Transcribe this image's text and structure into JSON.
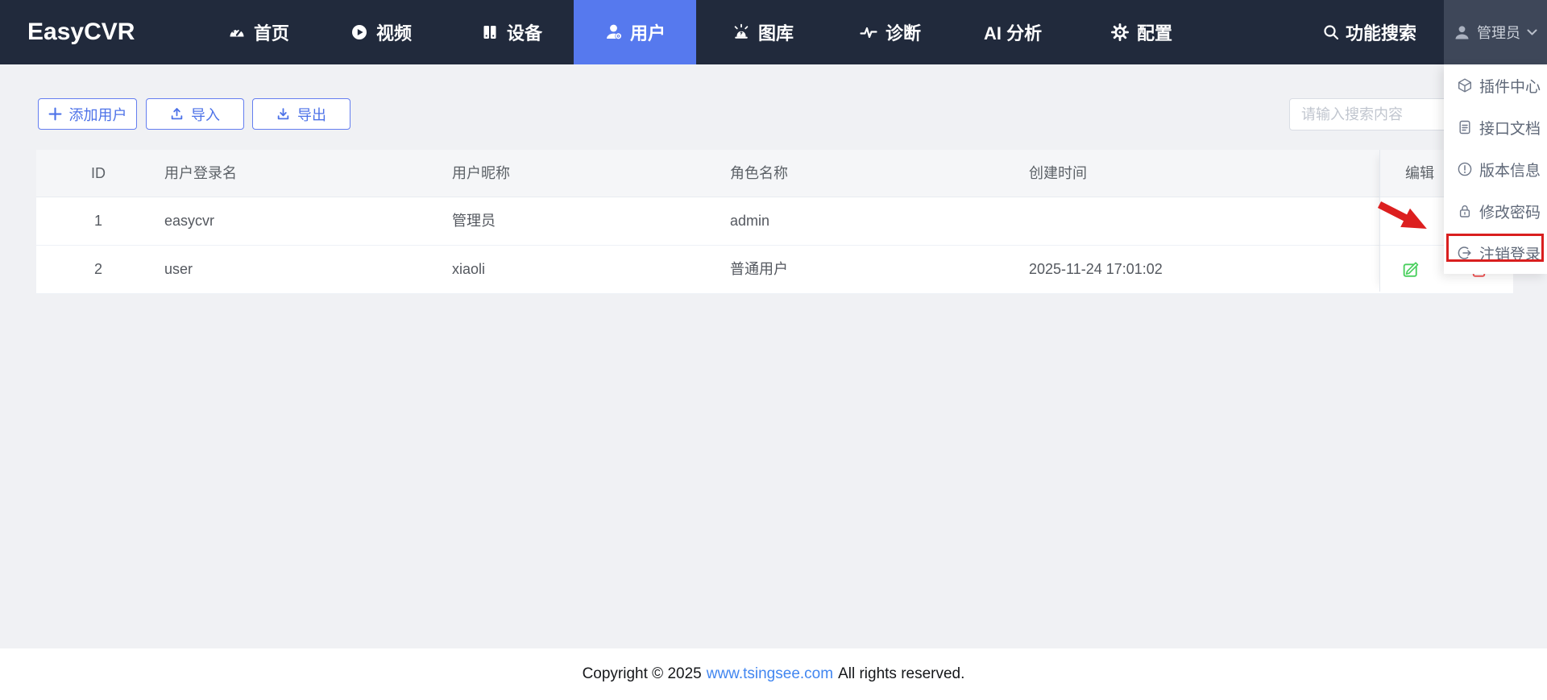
{
  "navbar": {
    "logo": "EasyCVR",
    "items": [
      {
        "label": "首页",
        "icon": "dashboard-icon"
      },
      {
        "label": "视频",
        "icon": "play-icon"
      },
      {
        "label": "设备",
        "icon": "device-icon"
      },
      {
        "label": "用户",
        "icon": "user-icon",
        "active": true
      },
      {
        "label": "图库",
        "icon": "siren-icon"
      },
      {
        "label": "诊断",
        "icon": "pulse-icon"
      },
      {
        "label": "AI 分析",
        "icon": null
      },
      {
        "label": "配置",
        "icon": "gear-icon"
      }
    ],
    "function_search_label": "功能搜索",
    "admin_label": "管理员"
  },
  "user_menu": {
    "items": [
      {
        "label": "插件中心",
        "icon": "plugin-cube-icon"
      },
      {
        "label": "接口文档",
        "icon": "document-icon"
      },
      {
        "label": "版本信息",
        "icon": "version-info-icon"
      },
      {
        "label": "修改密码",
        "icon": "lock-icon"
      },
      {
        "label": "注销登录",
        "icon": "logout-icon",
        "highlighted": true
      }
    ]
  },
  "toolbar": {
    "add_user_label": "添加用户",
    "import_label": "导入",
    "export_label": "导出",
    "search_placeholder": "请输入搜索内容"
  },
  "table": {
    "columns": [
      "ID",
      "用户登录名",
      "用户昵称",
      "角色名称",
      "创建时间",
      "编辑"
    ],
    "rows": [
      {
        "id": "1",
        "login": "easycvr",
        "nickname": "管理员",
        "role": "admin",
        "created": ""
      },
      {
        "id": "2",
        "login": "user",
        "nickname": "xiaoli",
        "role": "普通用户",
        "created": "2025-11-24 17:01:02"
      }
    ]
  },
  "footer": {
    "copyright_prefix": "Copyright © 2025",
    "link_text": "www.tsingsee.com",
    "copyright_suffix": "All rights reserved."
  },
  "colors": {
    "navbar_bg": "#212a3c",
    "active_tab_blue": "#5679ee",
    "admin_area_bg": "#3e4759",
    "button_blue": "#4d72e8",
    "annotation_red": "#d91f1f",
    "edit_green": "#49cf5d",
    "delete_red": "#f15353",
    "link_blue": "#4186f0",
    "page_bg": "#f0f1f4"
  }
}
